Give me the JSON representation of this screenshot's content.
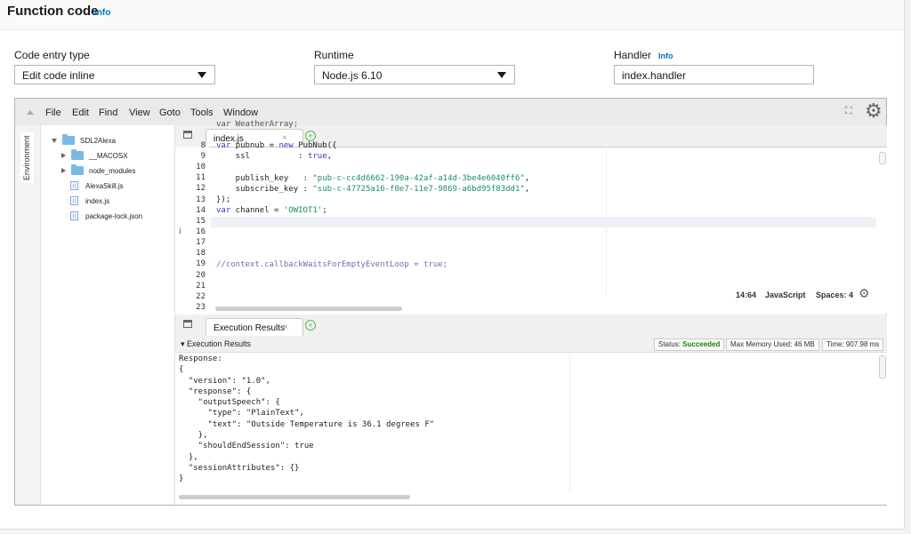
{
  "header": {
    "title": "Function code",
    "info": "Info"
  },
  "fields": {
    "code_entry": {
      "label": "Code entry type",
      "value": "Edit code inline"
    },
    "runtime": {
      "label": "Runtime",
      "value": "Node.js 6.10"
    },
    "handler": {
      "label": "Handler",
      "info": "Info",
      "value": "index.handler"
    }
  },
  "menu": [
    "File",
    "Edit",
    "Find",
    "View",
    "Goto",
    "Tools",
    "Window"
  ],
  "sidebar": {
    "env_label": "Environment"
  },
  "tree": {
    "root": "SDL2Alexa",
    "items": [
      "__MACOSX",
      "node_modules",
      "AlexaSkill.js",
      "index.js",
      "package-lock.json"
    ]
  },
  "editor": {
    "tab": "index.js",
    "close": "×",
    "line_numbers": [
      "8",
      "9",
      "10",
      "11",
      "12",
      "13",
      "14",
      "15",
      "16",
      "17",
      "18",
      "19",
      "20",
      "21",
      "22",
      "23"
    ],
    "lines": [
      "var WeatherArray;",
      "",
      "var pubnub = new PubNub({",
      "    ssl          : true,",
      "",
      "    publish_key   : \"pub-c-cc4d6662-190a-42af-a14d-3be4e6040ff6\",",
      "    subscribe_key : \"sub-c-47725a16-f0e7-11e7-9869-a6bd95f83dd1\",",
      "});",
      "var channel = 'OWIOT1';",
      "",
      "",
      "",
      "",
      "//context.callbackWaitsForEmptyEventLoop = true;",
      "",
      ""
    ],
    "info_marker": "i",
    "cursor": "14:64",
    "language": "JavaScript",
    "spaces": "Spaces: 4"
  },
  "results": {
    "tab": "Execution Results",
    "close": "×",
    "header": "▾ Execution Results",
    "status_label": "Status:",
    "status_value": "Succeeded",
    "memory": "Max Memory Used: 46 MB",
    "time": "Time: 907.98 ms",
    "output": "Response:\n{\n  \"version\": \"1.0\",\n  \"response\": {\n    \"outputSpeech\": {\n      \"type\": \"PlainText\",\n      \"text\": \"Outside Temperature is 36.1 degrees F\"\n    },\n    \"shouldEndSession\": true\n  },\n  \"sessionAttributes\": {}\n}"
  }
}
